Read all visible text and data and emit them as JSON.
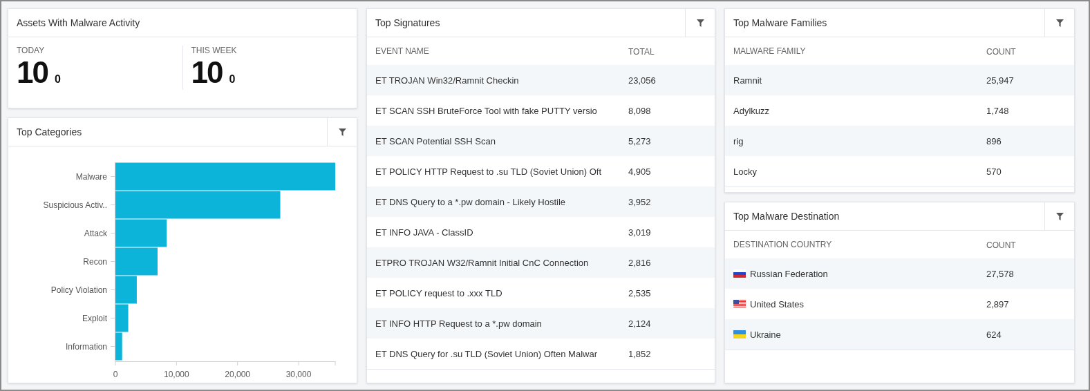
{
  "assets": {
    "title": "Assets With Malware Activity",
    "filter_button": false,
    "stats": [
      {
        "label": "TODAY",
        "value": "10",
        "delta": "0"
      },
      {
        "label": "THIS WEEK",
        "value": "10",
        "delta": "0"
      }
    ]
  },
  "top_categories": {
    "title": "Top Categories",
    "filter_button": true,
    "chart_data": {
      "type": "bar",
      "orientation": "horizontal",
      "categories": [
        "Malware",
        "Suspicious Activ..",
        "Attack",
        "Recon",
        "Policy Violation",
        "Exploit",
        "Information"
      ],
      "series": [
        {
          "color": "#0db4da",
          "values": [
            36000,
            27000,
            8400,
            6900,
            3500,
            2100,
            1100
          ]
        }
      ],
      "xlim": [
        0,
        36000
      ],
      "xticks": [
        0,
        {
          "value": 10000,
          "label": "10,000"
        },
        {
          "value": 20000,
          "label": "20,000"
        },
        {
          "value": 30000,
          "label": "30,000"
        }
      ]
    }
  },
  "top_signatures": {
    "title": "Top Signatures",
    "filter_button": true,
    "columns": [
      "EVENT NAME",
      "TOTAL"
    ],
    "rows": [
      {
        "name": "ET TROJAN Win32/Ramnit Checkin",
        "value": "23,056"
      },
      {
        "name": "ET SCAN SSH BruteForce Tool with fake PUTTY versio",
        "value": "8,098"
      },
      {
        "name": "ET SCAN Potential SSH Scan",
        "value": "5,273"
      },
      {
        "name": "ET POLICY HTTP Request to .su TLD (Soviet Union) Oft",
        "value": "4,905"
      },
      {
        "name": "ET DNS Query to a *.pw domain - Likely Hostile",
        "value": "3,952"
      },
      {
        "name": "ET INFO JAVA - ClassID",
        "value": "3,019"
      },
      {
        "name": "ETPRO TROJAN W32/Ramnit Initial CnC Connection",
        "value": "2,816"
      },
      {
        "name": "ET POLICY request to .xxx TLD",
        "value": "2,535"
      },
      {
        "name": "ET INFO HTTP Request to a *.pw domain",
        "value": "2,124"
      },
      {
        "name": "ET DNS Query for .su TLD (Soviet Union) Often Malwar",
        "value": "1,852"
      }
    ]
  },
  "top_malware_families": {
    "title": "Top Malware Families",
    "filter_button": true,
    "columns": [
      "MALWARE FAMILY",
      "COUNT"
    ],
    "rows": [
      {
        "name": "Ramnit",
        "value": "25,947"
      },
      {
        "name": "Adylkuzz",
        "value": "1,748"
      },
      {
        "name": "rig",
        "value": "896"
      },
      {
        "name": "Locky",
        "value": "570"
      }
    ]
  },
  "top_malware_destination": {
    "title": "Top Malware Destination",
    "filter_button": true,
    "columns": [
      "DESTINATION COUNTRY",
      "COUNT"
    ],
    "rows": [
      {
        "name": "Russian Federation",
        "value": "27,578",
        "kind": "ru"
      },
      {
        "name": "United States",
        "value": "2,897",
        "kind": "us"
      },
      {
        "name": "Ukraine",
        "value": "624",
        "kind": "ua"
      }
    ]
  }
}
